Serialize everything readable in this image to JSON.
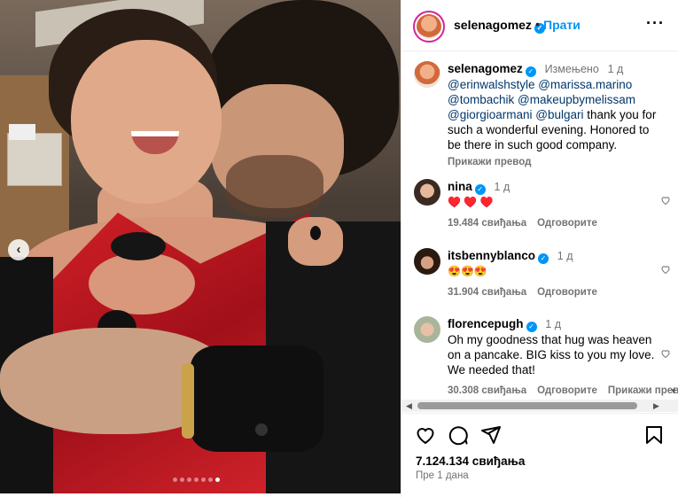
{
  "post": {
    "carousel": {
      "dot_count": 7,
      "active_index": 6,
      "prev_icon": "chevron-left-icon"
    },
    "author": {
      "username": "selenagomez",
      "verified": true,
      "follow_label": "Прати",
      "separator": "•",
      "more_icon": "more-horizontal-icon"
    },
    "caption": {
      "username": "selenagomez",
      "edited_label": "Измењено",
      "time": "1 д",
      "mentions": [
        "@erinwalshstyle",
        "@marissa.marino",
        "@tombachik",
        "@makeupbymelissam",
        "@giorgioarmani",
        "@bulgari"
      ],
      "text": "thank you for such a wonderful evening. Honored to be there in such good company.",
      "translate_label": "Прикажи превод"
    },
    "comments": [
      {
        "username": "nina",
        "verified": true,
        "time": "1 д",
        "text": "♥️ ♥️ ♥️",
        "likes": "19.484 свиђања",
        "reply_label": "Одговорите"
      },
      {
        "username": "itsbennyblanco",
        "verified": true,
        "time": "1 д",
        "text": "😍😍😍",
        "likes": "31.904 свиђања",
        "reply_label": "Одговорите"
      },
      {
        "username": "florencepugh",
        "verified": true,
        "time": "1 д",
        "text": "Oh my goodness that hug was heaven on a pancake. BIG kiss to you my love. We needed that!",
        "likes": "30.308 свиђања",
        "reply_label": "Одговорите",
        "translate_label": "Прикажи прев"
      }
    ],
    "actions": {
      "like_icon": "heart-icon",
      "comment_icon": "comment-icon",
      "share_icon": "share-icon",
      "save_icon": "bookmark-icon"
    },
    "like_count": "7.124.134 свиђања",
    "posted": "Пре 1 дана"
  },
  "colors": {
    "accent": "#0095f6",
    "muted": "#737373",
    "link": "#00376b",
    "dress": "#d32027"
  }
}
